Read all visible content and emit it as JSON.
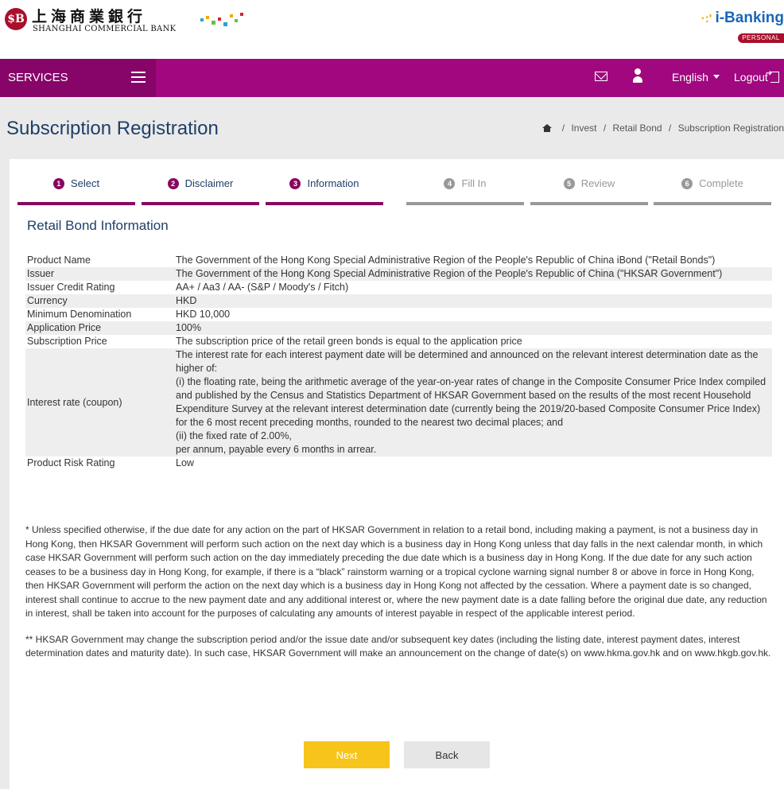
{
  "header": {
    "bank_name_cn": "上海商業銀行",
    "bank_name_en": "SHANGHAI COMMERCIAL BANK",
    "logo_mark": "$B",
    "ibanking": "i-Banking",
    "ibanking_tag": "PERSONAL"
  },
  "nav": {
    "services": "SERVICES",
    "language": "English",
    "logout": "Logout"
  },
  "page": {
    "title": "Subscription Registration",
    "breadcrumb": [
      "Invest",
      "Retail Bond",
      "Subscription Registration"
    ]
  },
  "steps": [
    {
      "num": "1",
      "label": "Select",
      "state": "active"
    },
    {
      "num": "2",
      "label": "Disclaimer",
      "state": "active"
    },
    {
      "num": "3",
      "label": "Information",
      "state": "active"
    },
    {
      "num": "4",
      "label": "Fill In",
      "state": "inactive"
    },
    {
      "num": "5",
      "label": "Review",
      "state": "inactive"
    },
    {
      "num": "6",
      "label": "Complete",
      "state": "inactive"
    }
  ],
  "section_title": "Retail Bond Information",
  "info_rows": [
    {
      "key": "Product Name",
      "value": "The Government of the Hong Kong Special Administrative Region of the People's Republic of China iBond (\"Retail Bonds\")"
    },
    {
      "key": "Issuer",
      "value": "The Government of the Hong Kong Special Administrative Region of the People's Republic of China (\"HKSAR Government\")"
    },
    {
      "key": "Issuer Credit Rating",
      "value": "AA+ / Aa3 / AA- (S&P / Moody's / Fitch)"
    },
    {
      "key": "Currency",
      "value": "HKD"
    },
    {
      "key": "Minimum Denomination",
      "value": "HKD 10,000"
    },
    {
      "key": "Application Price",
      "value": "100%"
    },
    {
      "key": "Subscription Price",
      "value": "The subscription price of the retail green bonds is equal to the application price"
    },
    {
      "key": "Interest rate (coupon)",
      "value_lines": [
        "The interest rate for each interest payment date will be determined and announced on the relevant interest determination date as the higher of:",
        "(i) the floating rate, being the arithmetic average of the year-on-year rates of change in the Composite Consumer Price Index compiled and published by the Census and Statistics Department of HKSAR Government based on the results of the most recent Household Expenditure Survey at the relevant interest determination date (currently being the 2019/20-based Composite Consumer Price Index) for the 6 most recent preceding months, rounded to the nearest two decimal places; and",
        "(ii) the fixed rate of 2.00%,",
        "per annum, payable every 6 months in arrear."
      ]
    },
    {
      "key": "Product Risk Rating",
      "value": "Low"
    }
  ],
  "notes": [
    "* Unless specified otherwise, if the due date for any action on the part of HKSAR Government in relation to a retail bond, including making a payment, is not a business day in Hong Kong, then HKSAR Government will perform such action on the next day which is a business day in Hong Kong unless that day falls in the next calendar month, in which case HKSAR Government will perform such action on the day immediately preceding the due date which is a business day in Hong Kong. If the due date for any such action ceases to be a business day in Hong Kong, for example, if there is a “black” rainstorm warning or a tropical cyclone warning signal number 8 or above in force in Hong Kong, then HKSAR Government will perform the action on the next day which is a business day in Hong Kong not affected by the cessation. Where a payment date is so changed, interest shall continue to accrue to the new payment date and any additional interest or, where the new payment date is a date falling before the original due date, any reduction in interest, shall be taken into account for the purposes of calculating any amounts of interest payable in respect of the applicable interest period.",
    "** HKSAR Government may change the subscription period and/or the issue date and/or subsequent key dates (including the listing date, interest payment dates, interest determination dates and maturity date). In such case, HKSAR Government will make an announcement on the change of date(s) on www.hkma.gov.hk and on www.hkgb.gov.hk."
  ],
  "buttons": {
    "next": "Next",
    "back": "Back"
  },
  "colors": {
    "nav": "#a1077f",
    "nav_dark": "#870468",
    "accent": "#88075f",
    "next_button": "#f7c41b",
    "title": "#1f3f67"
  }
}
